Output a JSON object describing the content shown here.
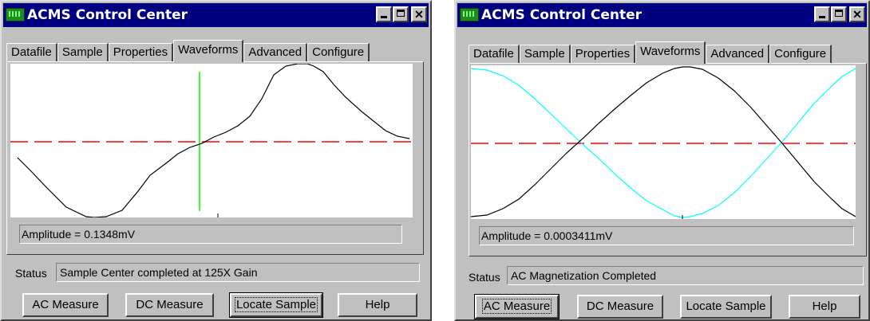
{
  "windows": [
    {
      "title": "ACMS Control Center",
      "tabs": [
        "Datafile",
        "Sample",
        "Properties",
        "Waveforms",
        "Advanced",
        "Configure"
      ],
      "active_tab": "Waveforms",
      "amplitude_text": "Amplitude = 0.1348mV",
      "status_label": "Status",
      "status_text": "Sample Center completed at 125X Gain",
      "buttons": [
        "AC Measure",
        "DC Measure",
        "Locate Sample",
        "Help"
      ],
      "focused_button": "Locate Sample",
      "colors": {
        "waveform": "#000000",
        "center_line": "#ff0000",
        "cursor": "#00ff00"
      }
    },
    {
      "title": "ACMS Control Center",
      "tabs": [
        "Datafile",
        "Sample",
        "Properties",
        "Waveforms",
        "Advanced",
        "Configure"
      ],
      "active_tab": "Waveforms",
      "amplitude_text": "Amplitude = 0.0003411mV",
      "status_label": "Status",
      "status_text": "AC Magnetization Completed",
      "buttons": [
        "AC Measure",
        "DC Measure",
        "Locate Sample",
        "Help"
      ],
      "focused_button": "AC Measure",
      "colors": {
        "waveform": "#000000",
        "waveform2": "#00ffff",
        "center_line": "#ff0000"
      }
    }
  ]
}
